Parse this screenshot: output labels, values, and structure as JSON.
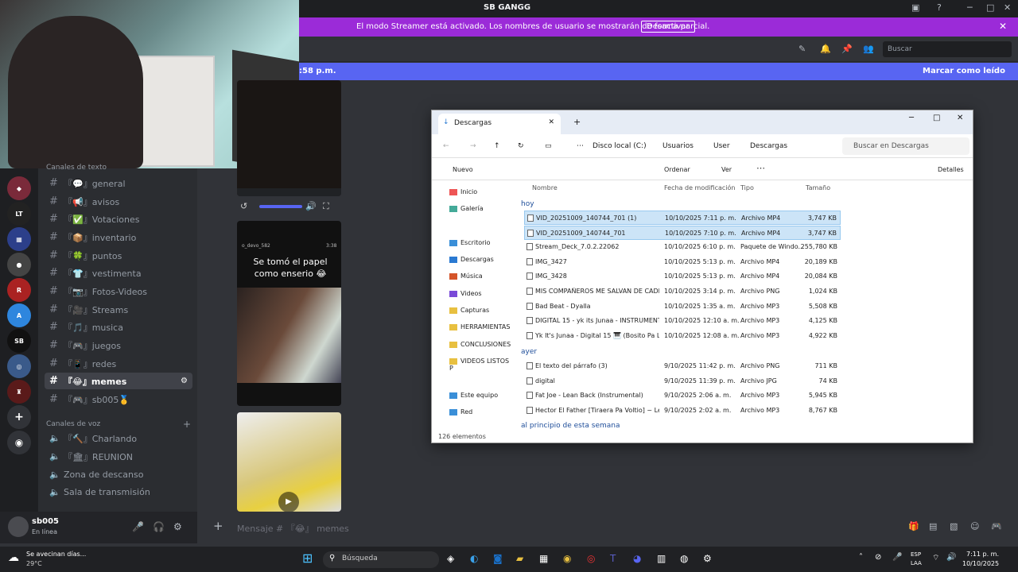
{
  "window": {
    "title": "SB GANGG"
  },
  "banner": {
    "message": "El modo Streamer está activado. Los nombres de usuario se mostrarán de forma parcial.",
    "button": "Desactivar"
  },
  "top": {
    "search_placeholder": "Buscar"
  },
  "new_messages": {
    "time": ":58 p.m.",
    "mark_read": "Marcar como leído"
  },
  "channels_category": "Canales de texto",
  "text_channels": [
    {
      "label": "『💬』general"
    },
    {
      "label": "『📢』avisos"
    },
    {
      "label": "『✅』Votaciones"
    },
    {
      "label": "『📦』inventario"
    },
    {
      "label": "『🍀』puntos"
    },
    {
      "label": "『👕』vestimenta"
    },
    {
      "label": "『📷』Fotos-Videos"
    },
    {
      "label": "『🎥』Streams"
    },
    {
      "label": "『🎵』musica"
    },
    {
      "label": "『🎮』juegos"
    },
    {
      "label": "『📱』redes"
    },
    {
      "label": "『😂』memes"
    },
    {
      "label": "『🎮』sb005🥇"
    }
  ],
  "voice_category": "Canales de voz",
  "voice_channels": [
    {
      "label": "『🔨』Charlando"
    },
    {
      "label": "『🏛』REUNION"
    },
    {
      "label": "Zona de descanso"
    },
    {
      "label": "Sala de transmisión"
    }
  ],
  "user": {
    "name": "sb005",
    "status": "En línea"
  },
  "message_input": {
    "placeholder": "Mensaje # 『😂』 memes"
  },
  "media": {
    "video_caption": "Se tomó el papel como enserio 😂",
    "video_user": "o_devo_582",
    "video_time": "3:38"
  },
  "explorer": {
    "tab": "Descargas",
    "breadcrumbs": [
      "Disco local (C:)",
      "Usuarios",
      "User",
      "Descargas"
    ],
    "search": "Buscar en Descargas",
    "toolbar": {
      "new": "Nuevo",
      "sort": "Ordenar",
      "view": "Ver",
      "details": "Detalles"
    },
    "nav": [
      "Inicio",
      "Galería",
      "Escritorio",
      "Descargas",
      "Música",
      "Videos",
      "Capturas",
      "HERRAMIENTAS",
      "CONCLUSIONES",
      "VIDEOS LISTOS P",
      "Este equipo",
      "Red"
    ],
    "columns": [
      "Nombre",
      "Fecha de modificación",
      "Tipo",
      "Tamaño"
    ],
    "group_today": "hoy",
    "group_yesterday": "ayer",
    "group_week": "al principio de esta semana",
    "files_today": [
      {
        "name": "VID_20251009_140744_701 (1)",
        "date": "10/10/2025 7:11 p. m.",
        "type": "Archivo MP4",
        "size": "3,747 KB"
      },
      {
        "name": "VID_20251009_140744_701",
        "date": "10/10/2025 7:10 p. m.",
        "type": "Archivo MP4",
        "size": "3,747 KB"
      },
      {
        "name": "Stream_Deck_7.0.2.22062",
        "date": "10/10/2025 6:10 p. m.",
        "type": "Paquete de Windo...",
        "size": "255,780 KB"
      },
      {
        "name": "IMG_3427",
        "date": "10/10/2025 5:13 p. m.",
        "type": "Archivo MP4",
        "size": "20,189 KB"
      },
      {
        "name": "IMG_3428",
        "date": "10/10/2025 5:13 p. m.",
        "type": "Archivo MP4",
        "size": "20,084 KB"
      },
      {
        "name": "MIS COMPAÑEROS ME SALVAN DE CADE...",
        "date": "10/10/2025 3:14 p. m.",
        "type": "Archivo PNG",
        "size": "1,024 KB"
      },
      {
        "name": "Bad Beat - Dyalla",
        "date": "10/10/2025 1:35 a. m.",
        "type": "Archivo MP3",
        "size": "5,508 KB"
      },
      {
        "name": "DIGITAL 15 - yk its Junaa - INSTRUMENTAL",
        "date": "10/10/2025 12:10 a. m.",
        "type": "Archivo MP3",
        "size": "4,125 KB"
      },
      {
        "name": "Yk It's Junaa - Digital 15 🎹 (Bosito Pa La ...",
        "date": "10/10/2025 12:08 a. m.",
        "type": "Archivo MP3",
        "size": "4,922 KB"
      }
    ],
    "files_yesterday": [
      {
        "name": "El texto del párrafo (3)",
        "date": "9/10/2025 11:42 p. m.",
        "type": "Archivo PNG",
        "size": "711 KB"
      },
      {
        "name": "digital",
        "date": "9/10/2025 11:39 p. m.",
        "type": "Archivo JPG",
        "size": "74 KB"
      },
      {
        "name": "Fat Joe - Lean Back (Instrumental)",
        "date": "9/10/2025 2:06 a. m.",
        "type": "Archivo MP3",
        "size": "5,945 KB"
      },
      {
        "name": "Hector El Father [Tiraera Pa Voltio] ~ Lea...",
        "date": "9/10/2025 2:02 a. m.",
        "type": "Archivo MP3",
        "size": "8,767 KB"
      }
    ],
    "status": "126 elementos"
  },
  "taskbar": {
    "weather_title": "Se avecinan días...",
    "weather_temp": "29°C",
    "search": "Búsqueda",
    "lang1": "ESP",
    "lang2": "LAA",
    "time": "7:11 p. m.",
    "date": "10/10/2025"
  }
}
